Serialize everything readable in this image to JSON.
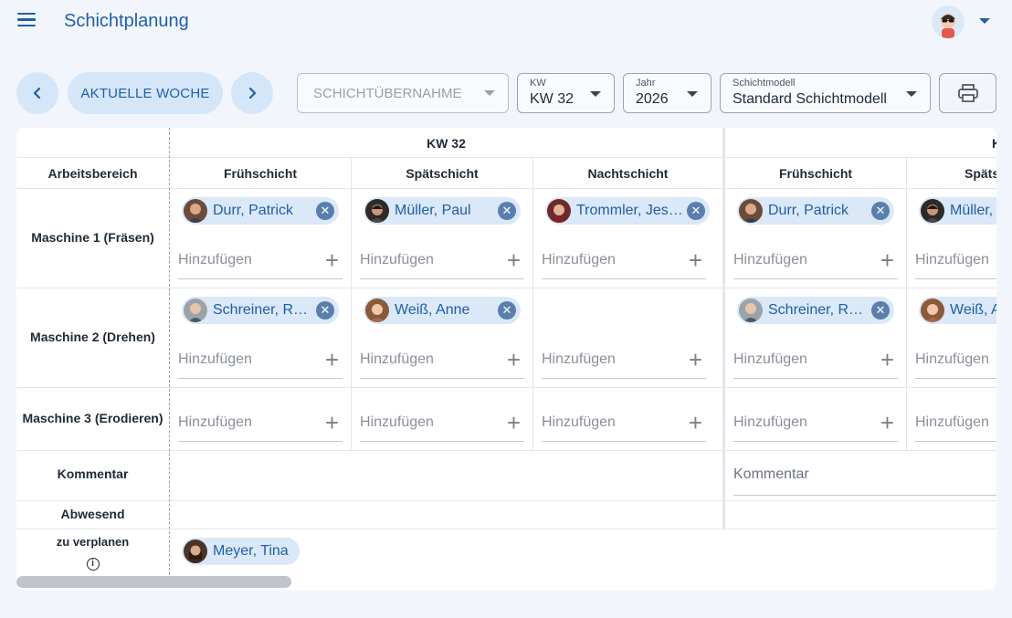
{
  "app": {
    "title": "Schichtplanung"
  },
  "toolbar": {
    "current_week_label": "AKTUELLE WOCHE",
    "shift_takeover_label": "SCHICHTÜBERNAHME",
    "kw": {
      "label": "KW",
      "value": "KW 32"
    },
    "year": {
      "label": "Jahr",
      "value": "2026"
    },
    "model": {
      "label": "Schichtmodell",
      "value": "Standard Schichtmodell"
    }
  },
  "table": {
    "weeks": [
      "KW 32",
      "K"
    ],
    "area_header": "Arbeitsbereich",
    "shifts": [
      "Frühschicht",
      "Spätschicht",
      "Nachtschicht",
      "Frühschicht",
      "Spätsc"
    ],
    "rows": [
      "Maschine 1 (Fräsen)",
      "Maschine 2 (Drehen)",
      "Maschine 3 (Erodieren)",
      "Kommentar",
      "Abwesend",
      "zu verplanen"
    ],
    "add_placeholder": "Hinzufügen",
    "comment_placeholder": "Kommentar",
    "employees": {
      "m1_frueh": "Durr, Patrick",
      "m1_spaet": "Müller, Paul",
      "m1_nacht": "Trommler, Jes…",
      "m1_frueh2": "Durr, Patrick",
      "m1_spaet2": "Müller, P",
      "m2_frueh": "Schreiner, René",
      "m2_spaet": "Weiß, Anne",
      "m2_frueh2": "Schreiner, René",
      "m2_spaet2": "Weiß, A",
      "unplanned": "Meyer, Tina"
    },
    "info_glyph": "i",
    "remove_glyph": "✕",
    "add_glyph": "+"
  },
  "colors": {
    "accent": "#1e5fa6",
    "chip_bg": "#dbe8f7",
    "chip_remove": "#5a7fae"
  }
}
